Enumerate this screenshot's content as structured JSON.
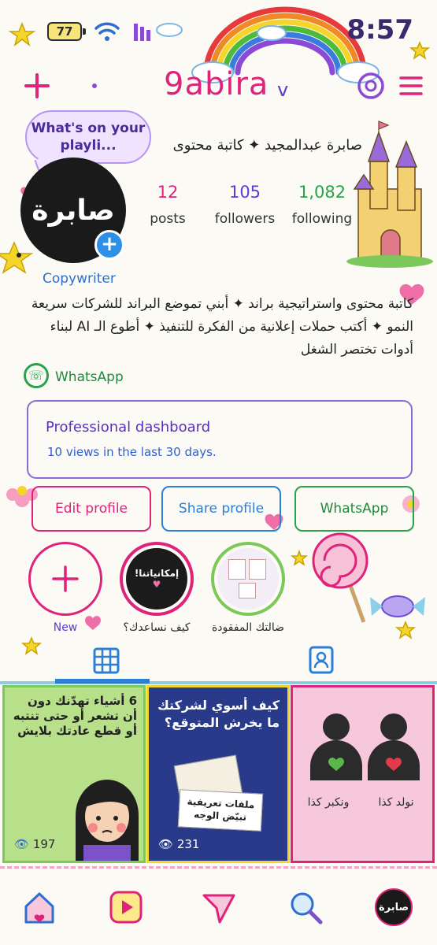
{
  "status_bar": {
    "battery": "77",
    "time": "8:57"
  },
  "header": {
    "username": "9abira",
    "caret": "v"
  },
  "note_bubble": {
    "text": "What's on your playli..."
  },
  "avatar": {
    "text": "صابرة"
  },
  "profile": {
    "full_name": "صابرة عبدالمجيد ✦ كاتبة محتوى",
    "stats": [
      {
        "value": "12",
        "label": "posts",
        "color": "#e0237a"
      },
      {
        "value": "105",
        "label": "followers",
        "color": "#5b3bd0"
      },
      {
        "value": "1,082",
        "label": "following",
        "color": "#27a34a"
      }
    ],
    "category": "Copywriter",
    "bio": "كاتبة محتوى واستراتيجية براند ✦ أبني تموضع البراند للشركات سريعة النمو ✦ أكتب حملات إعلانية من الفكرة للتنفيذ ✦ أطوع الـ AI لبناء أدوات تختصر الشغل",
    "link_label": "WhatsApp"
  },
  "dashboard": {
    "title": "Professional dashboard",
    "subtitle": "10 views in the last 30 days."
  },
  "actions": [
    {
      "label": "Edit profile",
      "color": "#e0237a"
    },
    {
      "label": "Share profile",
      "color": "#2d7fd6"
    },
    {
      "label": "WhatsApp",
      "color": "#27a34a"
    }
  ],
  "highlights": [
    {
      "label": "New",
      "icon": "plus-icon"
    },
    {
      "label": "كيف نساعدك؟",
      "cover_text": "إمكانياتنا!"
    },
    {
      "label": "ضالتك المفقودة"
    }
  ],
  "tabs": [
    {
      "icon": "grid-icon"
    },
    {
      "icon": "tagged-icon"
    }
  ],
  "posts": [
    {
      "title": "6 أشياء تهدّنك دون أن تشعر أو حتى تنتبه أو قطع عادتك بلايش",
      "views": "197",
      "bg": "#b8e08a"
    },
    {
      "title": "كيف أسوي لشركتك ما يخرش المتوقع؟",
      "card_text": "ملفات تعريفية تبيّض الوجه",
      "views": "231",
      "bg": "#2a3a8a"
    },
    {
      "captions": [
        "ونكبر كذا",
        "نولد كذا"
      ],
      "bg": "#f7c8dc"
    }
  ],
  "bottom_nav": [
    {
      "icon": "home-icon"
    },
    {
      "icon": "reels-icon"
    },
    {
      "icon": "send-icon"
    },
    {
      "icon": "search-icon"
    },
    {
      "icon": "profile-icon",
      "text": "صابرة"
    }
  ]
}
